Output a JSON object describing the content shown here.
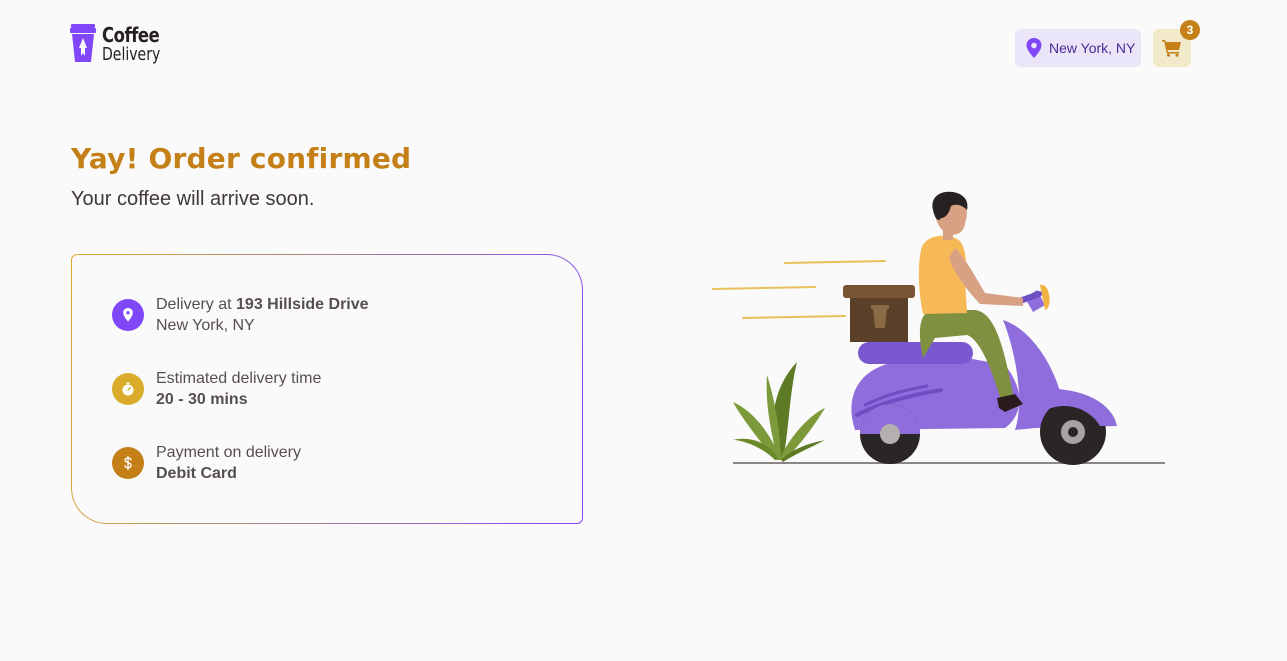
{
  "brand": {
    "name_line1": "Coffee",
    "name_line2": "Delivery"
  },
  "header": {
    "location_label": "New York, NY",
    "cart_count": "3"
  },
  "main": {
    "title": "Yay! Order confirmed",
    "subtitle": "Your coffee will arrive soon."
  },
  "order_info": {
    "delivery_prefix": "Delivery at",
    "delivery_address": "193 Hillside Drive",
    "delivery_city": "New York, NY",
    "time_label": "Estimated delivery time",
    "time_value": "20 - 30 mins",
    "payment_label": "Payment on delivery",
    "payment_value": "Debit Card"
  },
  "colors": {
    "brand_purple": "#8047f8",
    "brand_yellow": "#dbac2c",
    "brand_dark_yellow": "#c47f17",
    "purple_light": "#ebe5f9",
    "yellow_light": "#f1e9c9"
  },
  "icons": {
    "logo": "coffee-cup-rocket-icon",
    "location": "map-pin-icon",
    "cart": "shopping-cart-icon",
    "delivery": "map-pin-icon",
    "time": "timer-icon",
    "payment": "currency-dollar-icon"
  }
}
